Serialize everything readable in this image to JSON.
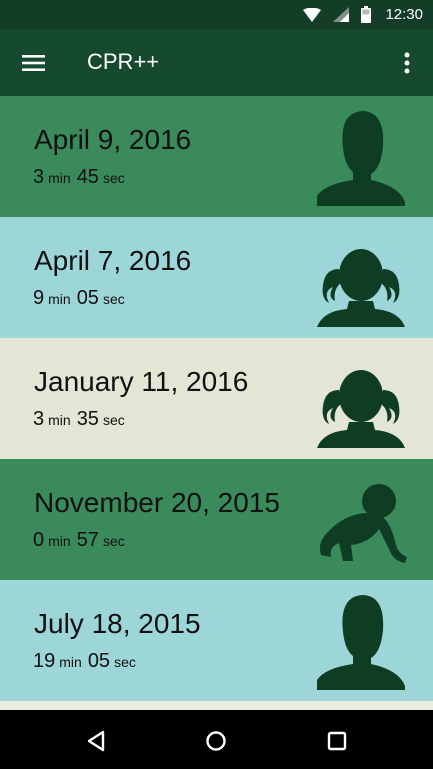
{
  "status_bar": {
    "time": "12:30",
    "icons": [
      "wifi-icon",
      "signal-icon",
      "battery-icon"
    ],
    "bg": "#143d28"
  },
  "app_bar": {
    "title": "CPR++",
    "menu_icon": "hamburger-menu-icon",
    "overflow_icon": "overflow-menu-icon",
    "bg": "#154a2e"
  },
  "colors": {
    "silhouette": "#0f3d24",
    "green_card": "#3a8a5c",
    "blue_card": "#9dd6d8",
    "beige_card": "#e3e6d5",
    "nav_bar": "#000000"
  },
  "sessions": [
    {
      "date": "April 9, 2016",
      "min": "3",
      "sec": "45",
      "min_unit": "min",
      "sec_unit": "sec",
      "avatar": "adult-silhouette-icon",
      "color": "#3a8a5c"
    },
    {
      "date": "April 7, 2016",
      "min": "9",
      "sec": "05",
      "min_unit": "min",
      "sec_unit": "sec",
      "avatar": "child-silhouette-icon",
      "color": "#9dd6d8"
    },
    {
      "date": "January 11, 2016",
      "min": "3",
      "sec": "35",
      "min_unit": "min",
      "sec_unit": "sec",
      "avatar": "child-silhouette-icon",
      "color": "#e3e6d5"
    },
    {
      "date": "November 20, 2015",
      "min": "0",
      "sec": "57",
      "min_unit": "min",
      "sec_unit": "sec",
      "avatar": "infant-silhouette-icon",
      "color": "#3a8a5c"
    },
    {
      "date": "July 18, 2015",
      "min": "19",
      "sec": "05",
      "min_unit": "min",
      "sec_unit": "sec",
      "avatar": "adult-silhouette-icon",
      "color": "#9dd6d8"
    }
  ],
  "nav_bar": {
    "icons": [
      "back-icon",
      "home-icon",
      "recents-icon"
    ]
  }
}
